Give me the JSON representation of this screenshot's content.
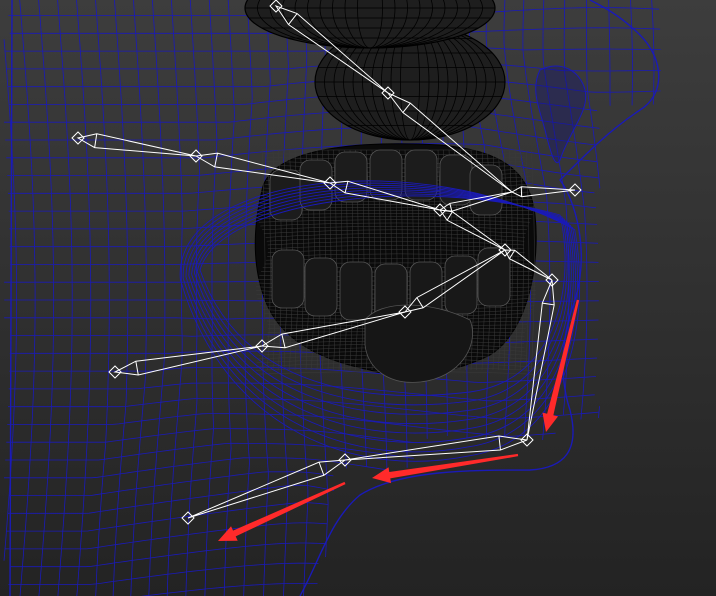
{
  "viewport": {
    "background_top": "#3d3d3d",
    "background_bottom": "#232323",
    "wire_color": "#1a1ab8",
    "mesh_color": "#000000",
    "bone_color": "#ffffff",
    "arrow_color": "#ff2a2a"
  },
  "icons": {
    "arrow": "red-arrow-icon"
  }
}
